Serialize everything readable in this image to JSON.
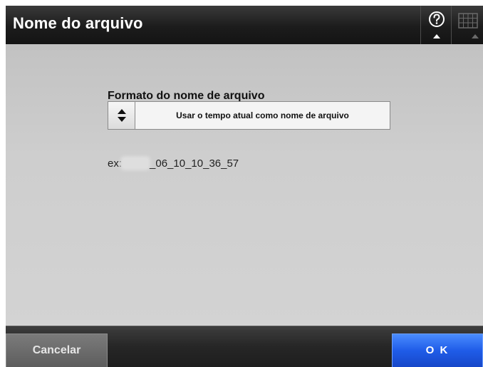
{
  "window": {
    "title": "Nome do arquivo"
  },
  "toolbar": {
    "help_icon": "question-circle-icon",
    "keyboard_icon": "keyboard-icon"
  },
  "form": {
    "label": "Formato do nome de arquivo",
    "selected_option": "Usar o tempo atual como nome de arquivo",
    "stepper_icon": "up-down-arrows-icon",
    "example_prefix": "ex:",
    "example_suffix": "_06_10_10_36_57"
  },
  "footer": {
    "cancel_label": "Cancelar",
    "ok_label": "O K"
  },
  "colors": {
    "titlebar": "#1c1c1c",
    "content_bg": "#cecece",
    "ok_button": "#1f5ce8",
    "cancel_button": "#6a6a6a"
  }
}
